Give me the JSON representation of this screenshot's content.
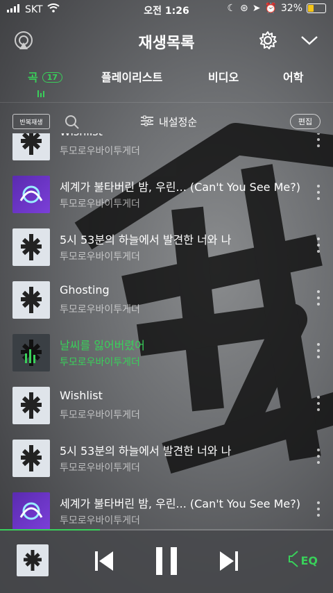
{
  "status": {
    "carrier": "SKT",
    "time": "오전 1:26",
    "battery": "32%",
    "battery_level": 0.32
  },
  "header": {
    "title": "재생목록"
  },
  "tabs": [
    {
      "label": "곡",
      "badge": "17",
      "active": true
    },
    {
      "label": "플레이리스트"
    },
    {
      "label": "비디오"
    },
    {
      "label": "어학"
    }
  ],
  "toolbar": {
    "repeat_label": "반복재생",
    "sort_label": "내설정순",
    "edit_label": "편집"
  },
  "songs": [
    {
      "title": "Wishlist",
      "artist": "투모로우바이투게더",
      "art": "light"
    },
    {
      "title": "세계가 불타버린 밤, 우린... (Can't You See Me?)",
      "artist": "투모로우바이투게더",
      "art": "purple"
    },
    {
      "title": "5시 53분의 하늘에서 발견한 너와 나",
      "artist": "투모로우바이투게더",
      "art": "light"
    },
    {
      "title": "Ghosting",
      "artist": "투모로우바이투게더",
      "art": "light"
    },
    {
      "title": "날씨를 잃어버렸어",
      "artist": "투모로우바이투게더",
      "art": "dark",
      "playing": true
    },
    {
      "title": "Wishlist",
      "artist": "투모로우바이투게더",
      "art": "light"
    },
    {
      "title": "5시 53분의 하늘에서 발견한 너와 나",
      "artist": "투모로우바이투게더",
      "art": "light"
    },
    {
      "title": "세계가 불타버린 밤, 우린... (Can't You See Me?)",
      "artist": "투모로우바이투게더",
      "art": "purple"
    }
  ],
  "player": {
    "eq_label": "EQ",
    "progress": 0.3
  },
  "colors": {
    "accent": "#39d05a"
  }
}
